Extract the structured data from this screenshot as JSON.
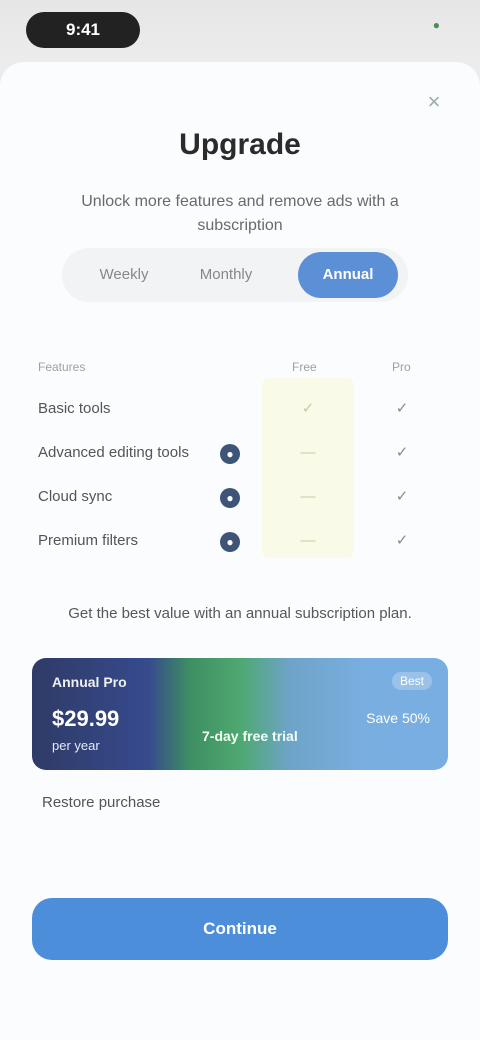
{
  "status": {
    "time": "9:41",
    "indicator": "●"
  },
  "sheet": {
    "close_icon": "×",
    "title": "Upgrade",
    "subtitle": "Unlock more features and remove ads with a subscription"
  },
  "billing": {
    "options": [
      "Weekly",
      "Monthly",
      "Annual"
    ],
    "selected": "Annual"
  },
  "table": {
    "headers": [
      "Features",
      "",
      "Free",
      "Pro"
    ],
    "rows": [
      {
        "feature": "Basic tools",
        "icon": "",
        "free": "✓",
        "pro": "✓"
      },
      {
        "feature": "Advanced editing tools",
        "icon": "●",
        "free": "—",
        "pro": "✓"
      },
      {
        "feature": "Cloud sync",
        "icon": "●",
        "free": "—",
        "pro": "✓"
      },
      {
        "feature": "Premium filters",
        "icon": "●",
        "free": "—",
        "pro": "✓"
      }
    ]
  },
  "note": "Get the best value with an annual subscription plan.",
  "plan_card": {
    "name": "Annual Pro",
    "badge": "Best",
    "price": "$29.99",
    "period": "per year",
    "bonus": "7-day free trial",
    "save": "Save 50%"
  },
  "restore_label": "Restore purchase",
  "cta_label": "Continue",
  "colors": {
    "accent": "#4d8edb",
    "free_column": "#fafae8",
    "card_start": "#2f3b66",
    "card_mid": "#4ea870",
    "card_end": "#78aee2"
  },
  "icons": {
    "close": "close-icon",
    "feature": "feature-dot-icon"
  }
}
